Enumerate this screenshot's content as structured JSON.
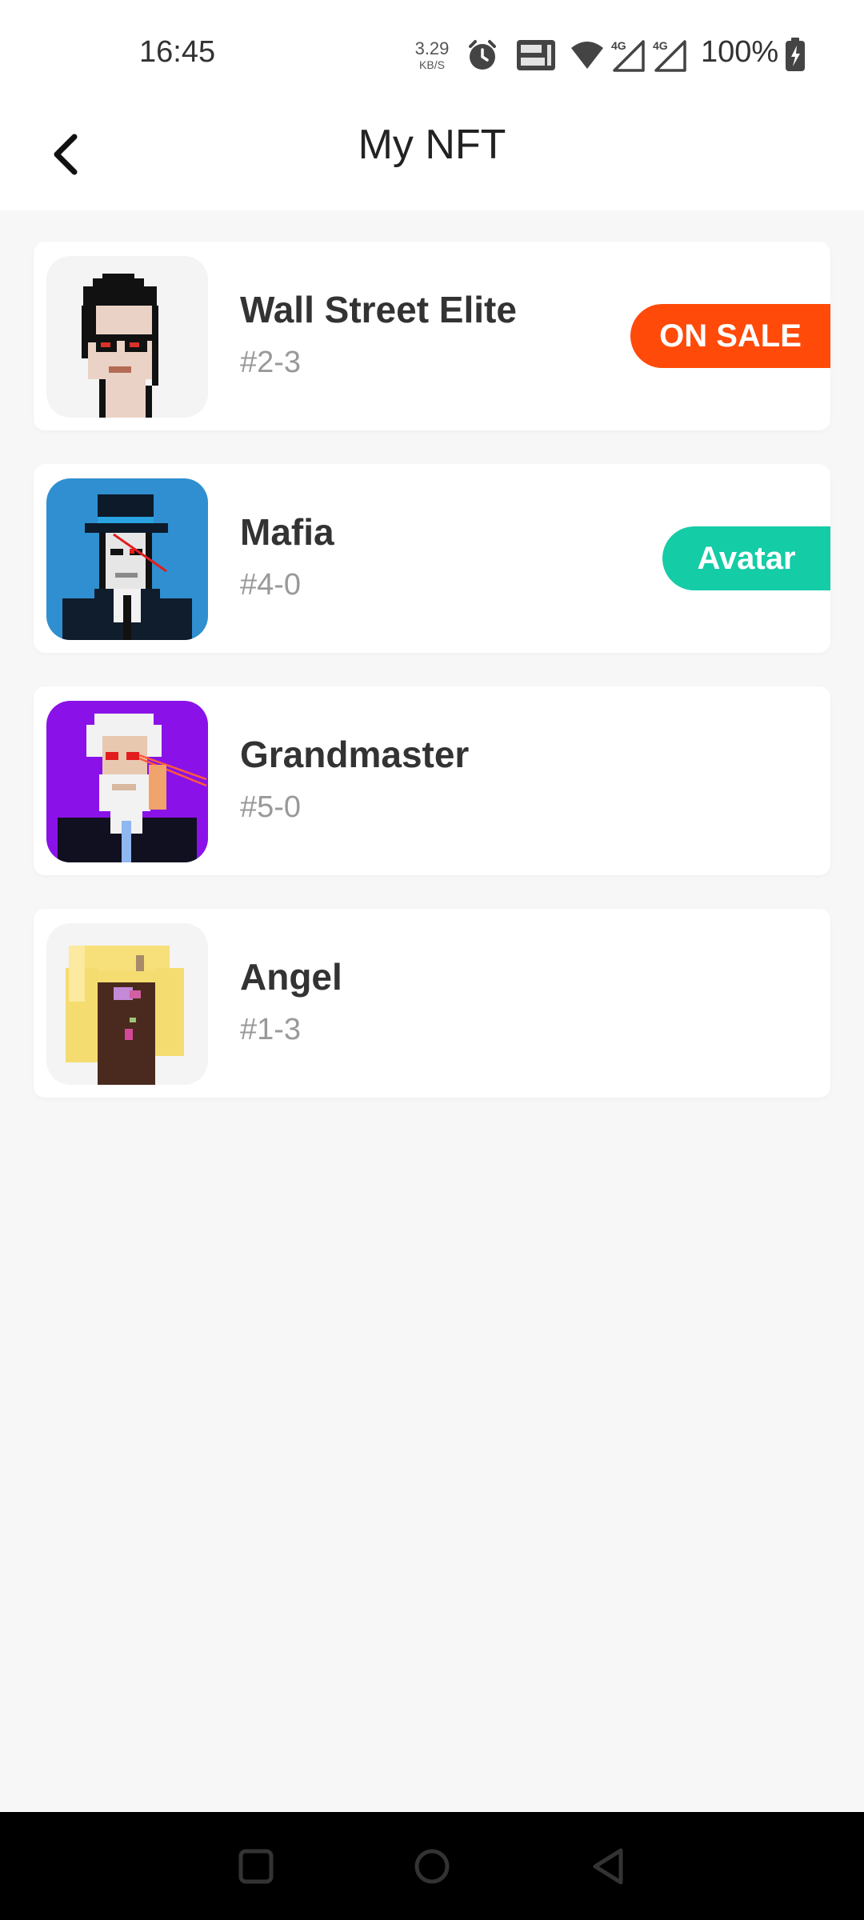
{
  "status_bar": {
    "time": "16:45",
    "net_speed_value": "3.29",
    "net_speed_unit": "KB/S",
    "battery": "100%",
    "icons": [
      "alarm-icon",
      "volte-icon",
      "wifi-icon",
      "signal-4g-icon",
      "signal-4g-icon",
      "battery-charging-icon"
    ]
  },
  "header": {
    "back_icon": "chevron-left-icon",
    "title": "My NFT"
  },
  "nfts": [
    {
      "name": "Wall Street Elite",
      "id": "#2-3",
      "badge": "ON SALE",
      "badge_color": "#ff4a0a",
      "thumb_bg": "#f4f4f4"
    },
    {
      "name": "Mafia",
      "id": "#4-0",
      "badge": "Avatar",
      "badge_color": "#14cca6",
      "thumb_bg": "#2f8fd0"
    },
    {
      "name": "Grandmaster",
      "id": "#5-0",
      "badge": "",
      "thumb_bg": "#8a12e8"
    },
    {
      "name": "Angel",
      "id": "#1-3",
      "badge": "",
      "thumb_bg": "#f4f4f4"
    }
  ],
  "nav_bar": {
    "buttons": [
      "recents-square-icon",
      "home-circle-icon",
      "back-triangle-icon"
    ]
  },
  "colors": {
    "background": "#f7f7f7",
    "on_sale": "#ff4a0a",
    "avatar": "#14cca6"
  }
}
